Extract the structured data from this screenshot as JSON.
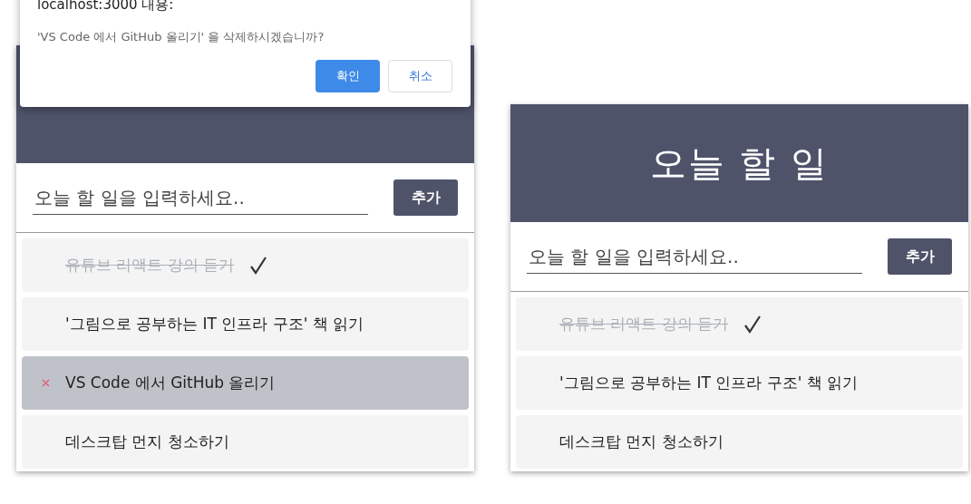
{
  "panels": [
    {
      "input": {
        "placeholder": "오늘 할 일을 입력하세요.."
      },
      "add_button": "추가",
      "items": [
        {
          "text": "유튜브 리액트 강의 듣기",
          "done": true,
          "highlighted": false
        },
        {
          "text": "'그림으로 공부하는 IT 인프라 구조' 책 읽기",
          "done": false,
          "highlighted": false
        },
        {
          "text": "VS Code 에서 GitHub 올리기",
          "done": false,
          "highlighted": true
        },
        {
          "text": "데스크탑 먼지 청소하기",
          "done": false,
          "highlighted": false
        }
      ]
    },
    {
      "title": "오늘 할 일",
      "input": {
        "placeholder": "오늘 할 일을 입력하세요.."
      },
      "add_button": "추가",
      "items": [
        {
          "text": "유튜브 리액트 강의 듣기",
          "done": true,
          "highlighted": false
        },
        {
          "text": "'그림으로 공부하는 IT 인프라 구조' 책 읽기",
          "done": false,
          "highlighted": false
        },
        {
          "text": "데스크탑 먼지 청소하기",
          "done": false,
          "highlighted": false
        }
      ]
    }
  ],
  "dialog": {
    "title": "localhost:3000 내용:",
    "message": "'VS Code 에서 GitHub 올리기' 을 삭제하시겠습니까?",
    "buttons": [
      {
        "label": "확인",
        "primary": true
      },
      {
        "label": "취소",
        "primary": false
      }
    ]
  }
}
